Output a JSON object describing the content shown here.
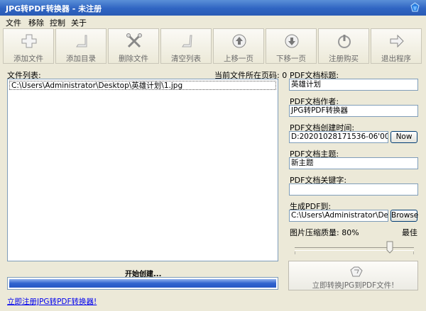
{
  "window": {
    "title": "JPG转PDF转换器 - 未注册"
  },
  "menu": [
    "文件",
    "移除",
    "控制",
    "关于"
  ],
  "toolbar": [
    {
      "label": "添加文件",
      "icon": "add-file-icon"
    },
    {
      "label": "添加目录",
      "icon": "add-folder-icon"
    },
    {
      "label": "删除文件",
      "icon": "delete-file-icon"
    },
    {
      "label": "清空列表",
      "icon": "clear-list-icon"
    },
    {
      "label": "上移一页",
      "icon": "move-up-icon"
    },
    {
      "label": "下移一页",
      "icon": "move-down-icon"
    },
    {
      "label": "注册购买",
      "icon": "register-icon"
    },
    {
      "label": "退出程序",
      "icon": "exit-icon"
    }
  ],
  "files": {
    "label": "文件列表:",
    "page_label": "当前文件所在页码: 0",
    "items": [
      "C:\\Users\\Administrator\\Desktop\\英雄计划\\1.jpg"
    ]
  },
  "pdf": {
    "title_label": "PDF文档标题:",
    "title_value": "英雄计划",
    "author_label": "PDF文档作者:",
    "author_value": "JPG转PDF转换器",
    "created_label": "PDF文档创建时间:",
    "created_value": "D:20201028171536-06'00",
    "now_button": "Now",
    "subject_label": "PDF文档主题:",
    "subject_value": "新主题",
    "keywords_label": "PDF文档关键字:",
    "keywords_value": "",
    "output_label": "生成PDF到:",
    "output_value": "C:\\Users\\Administrator\\Desktop",
    "browse_button": "Browse",
    "quality_label": "图片压缩质量: 80%",
    "quality_max_label": "最佳",
    "quality_level": 0.8
  },
  "status": {
    "text": "开始创建...",
    "progress": 1.0
  },
  "convert_button": "立即转换JPG到PDF文件!",
  "register_link": "立即注册JPG转PDF转换器!"
}
